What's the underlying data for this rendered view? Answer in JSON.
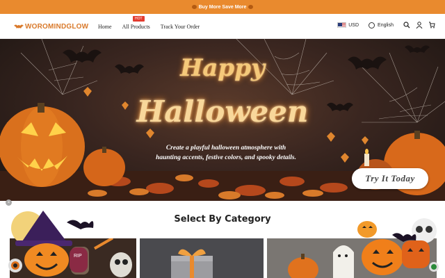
{
  "promo": {
    "text": "Buy More Save More"
  },
  "brand": {
    "logo_text": "WOROMINDGLOW",
    "accent": "#e98a2e",
    "logo_color": "#d9792a"
  },
  "nav": {
    "items": [
      {
        "label": "Home"
      },
      {
        "label": "All Products",
        "badge": "HOT"
      },
      {
        "label": "Track Your Order"
      }
    ],
    "currency": "USD",
    "language": "English"
  },
  "banner": {
    "title_line1": "Happy",
    "title_line2": "Halloween",
    "tagline_line1": "Create a playful halloween atmosphere with",
    "tagline_line2": "haunting accents, festive colors, and spooky details.",
    "cta": "Try It Today"
  },
  "category": {
    "heading": "Select By Category",
    "cards": [
      {
        "name": "halloween-decor",
        "bg": "#3a2a22"
      },
      {
        "name": "gift-box",
        "bg": "#4a4a4e"
      },
      {
        "name": "pumpkin-ghost",
        "bg": "#6d6a66"
      }
    ]
  },
  "icons": [
    "search-icon",
    "user-icon",
    "cart-icon",
    "globe-icon",
    "flag-us-icon",
    "close-icon"
  ],
  "deco_labels": {
    "tombstone": "RIP"
  }
}
